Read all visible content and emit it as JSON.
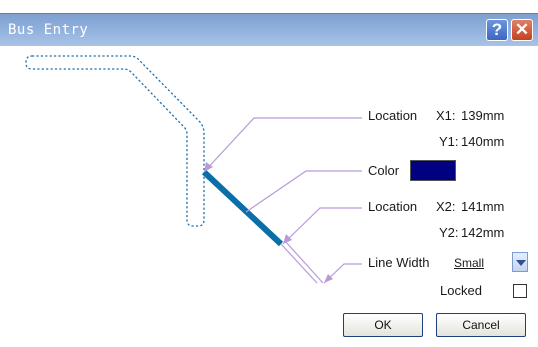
{
  "window": {
    "title": "Bus Entry",
    "help_label": "?",
    "close_label": "✕"
  },
  "fields": {
    "location1_label": "Location",
    "x1_label": "X1:",
    "x1_value": "139mm",
    "y1_label": "Y1:",
    "y1_value": "140mm",
    "color_label": "Color",
    "color_value": "#000080",
    "location2_label": "Location",
    "x2_label": "X2:",
    "x2_value": "141mm",
    "y2_label": "Y2:",
    "y2_value": "142mm",
    "line_width_label": "Line Width",
    "line_width_value": "Small",
    "locked_label": "Locked",
    "locked_checked": false
  },
  "buttons": {
    "ok_label": "OK",
    "cancel_label": "Cancel"
  }
}
